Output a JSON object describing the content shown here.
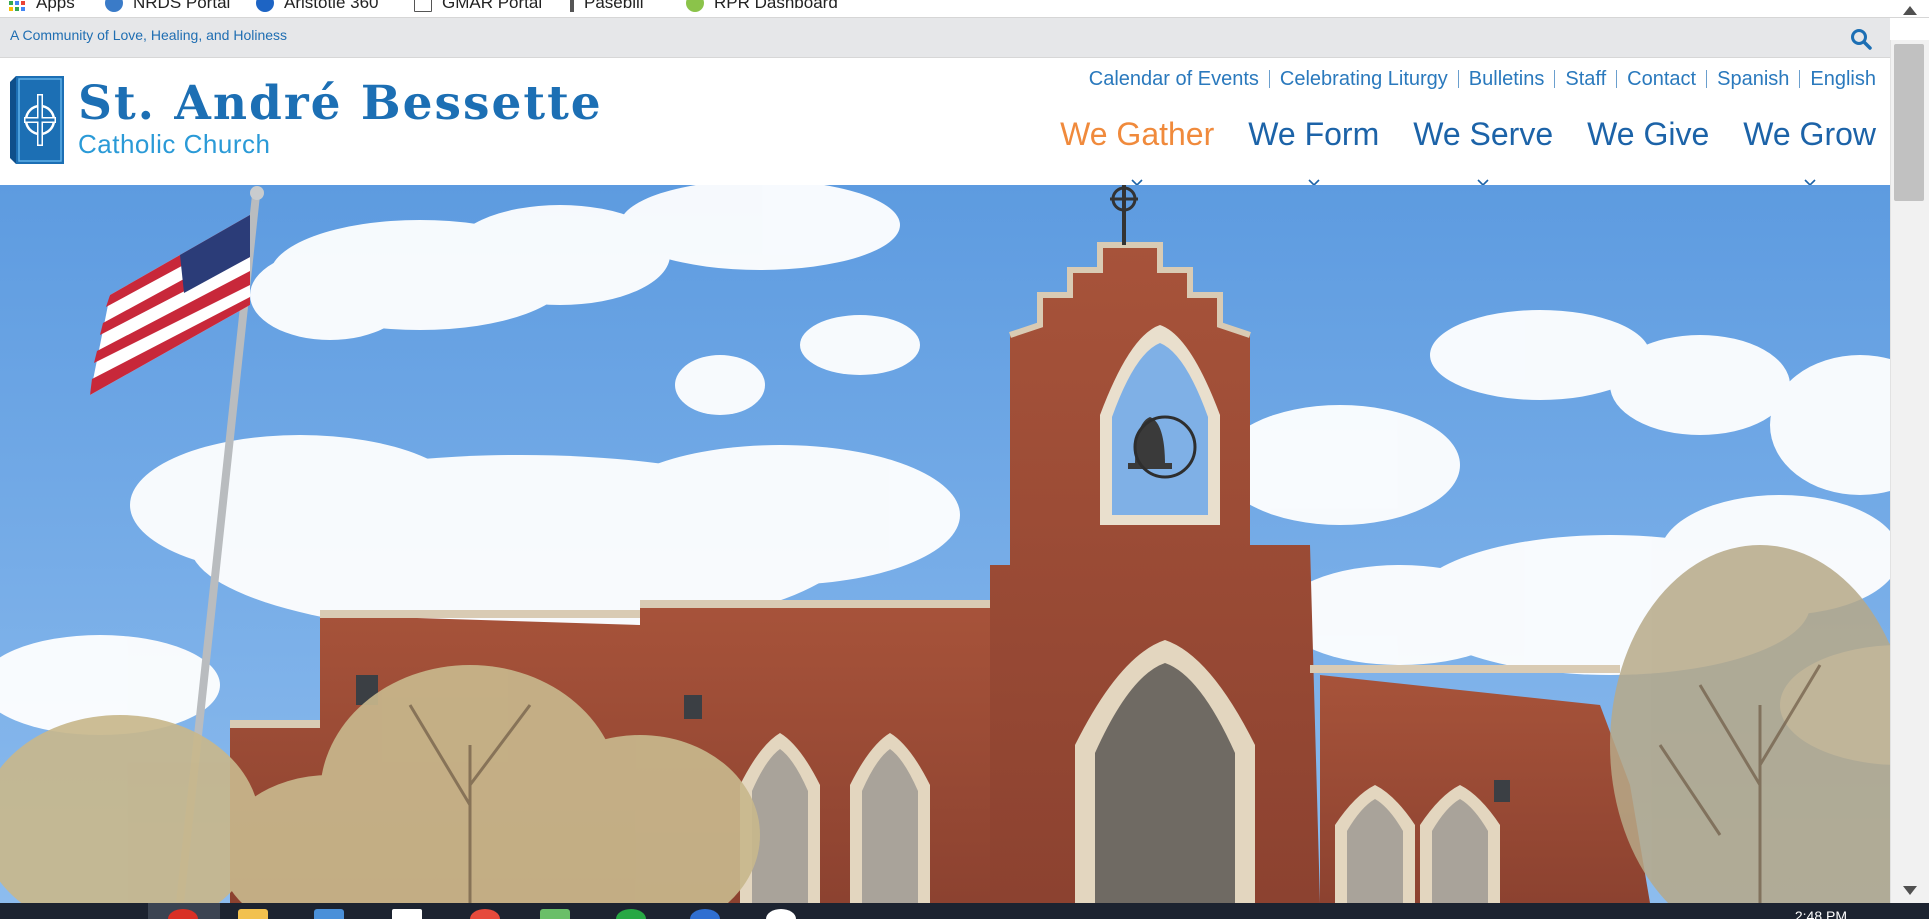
{
  "browser": {
    "bookmarks": [
      {
        "label": "Apps",
        "icon": "apps-grid-icon"
      },
      {
        "label": "NRDS Portal",
        "icon": "globe-icon"
      },
      {
        "label": "Aristotle 360",
        "icon": "aristotle-icon"
      },
      {
        "label": "GMAR Portal",
        "icon": "page-icon"
      },
      {
        "label": "Paseblll",
        "icon": "bookmark-icon"
      },
      {
        "label": "RPR Dashboard",
        "icon": "rpr-icon"
      }
    ]
  },
  "site": {
    "tagline": "A Community of Love, Healing, and Holiness",
    "brand_name": "St. André Bessette",
    "brand_sub": "Catholic Church",
    "utility_links": [
      "Calendar of Events",
      "Celebrating Liturgy",
      "Bulletins",
      "Staff",
      "Contact",
      "Spanish",
      "English"
    ],
    "main_nav": [
      {
        "label": "We Gather",
        "active": true,
        "has_dropdown": true
      },
      {
        "label": "We Form",
        "active": false,
        "has_dropdown": true
      },
      {
        "label": "We Serve",
        "active": false,
        "has_dropdown": true
      },
      {
        "label": "We Give",
        "active": false,
        "has_dropdown": false
      },
      {
        "label": "We Grow",
        "active": false,
        "has_dropdown": true
      }
    ]
  },
  "taskbar": {
    "clock": "2:48 PM"
  },
  "colors": {
    "brand_blue": "#1c6fb4",
    "brand_light_blue": "#2a9ad7",
    "active_orange": "#f08a3c",
    "utility_bg": "#e6e7e9"
  }
}
